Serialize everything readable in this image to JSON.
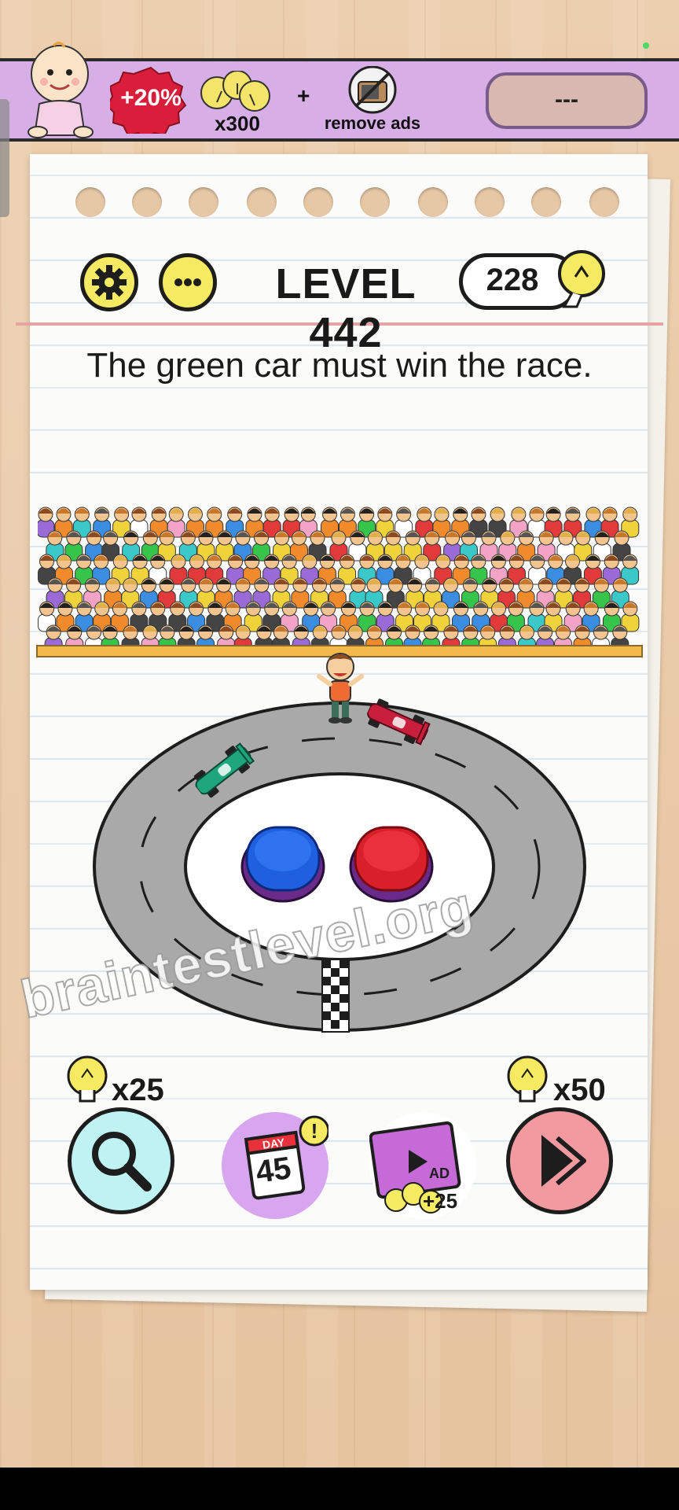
{
  "promo": {
    "discount": "+20%",
    "hint_count": "x300",
    "plus": "+",
    "remove_ads": "remove ads",
    "price": "---"
  },
  "header": {
    "level": "LEVEL 442",
    "hints": "228"
  },
  "puzzle": {
    "question": "The green car must win the race."
  },
  "watermark": "braintestlevel.org",
  "tools": {
    "search_cost": "x25",
    "day": "45",
    "day_label": "DAY",
    "ad_label": "AD",
    "ad_reward": "+25",
    "skip_cost": "x50"
  },
  "colors": {
    "banner": "#d7aee6",
    "blue_button": "#1f5fe0",
    "red_button": "#d81f2a",
    "green_car": "#1fa67a",
    "red_car": "#c8203c"
  }
}
